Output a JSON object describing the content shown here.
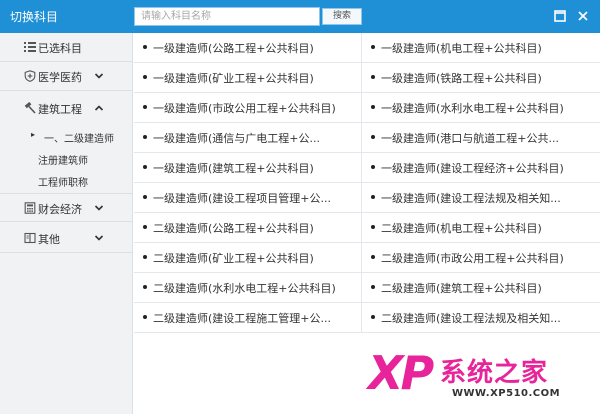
{
  "window": {
    "title": "切换科目"
  },
  "search": {
    "placeholder": "请输入科目名称",
    "button_label": "搜索"
  },
  "sidebar": {
    "items": [
      {
        "label": "已选科目",
        "icon": "list-icon"
      },
      {
        "label": "医学医药",
        "icon": "shield-icon",
        "expanded": false
      },
      {
        "label": "建筑工程",
        "icon": "hammer-icon",
        "expanded": true
      },
      {
        "label": "财会经济",
        "icon": "calculator-icon",
        "expanded": false
      },
      {
        "label": "其他",
        "icon": "book-icon",
        "expanded": false
      }
    ],
    "subitems": [
      {
        "label": "一、二级建造师",
        "active": true,
        "marker": "▸"
      },
      {
        "label": "注册建筑师",
        "active": false
      },
      {
        "label": "工程师职称",
        "active": false
      }
    ]
  },
  "subjects": {
    "rows": [
      [
        "一级建造师(公路工程+公共科目)",
        "一级建造师(机电工程+公共科目)"
      ],
      [
        "一级建造师(矿业工程+公共科目)",
        "一级建造师(铁路工程+公共科目)"
      ],
      [
        "一级建造师(市政公用工程+公共科目)",
        "一级建造师(水利水电工程+公共科目)"
      ],
      [
        "一级建造师(通信与广电工程+公...",
        "一级建造师(港口与航道工程+公共..."
      ],
      [
        "一级建造师(建筑工程+公共科目)",
        "一级建造师(建设工程经济+公共科目)"
      ],
      [
        "一级建造师(建设工程项目管理+公...",
        "一级建造师(建设工程法规及相关知..."
      ],
      [
        "二级建造师(公路工程+公共科目)",
        "二级建造师(机电工程+公共科目)"
      ],
      [
        "二级建造师(矿业工程+公共科目)",
        "二级建造师(市政公用工程+公共科目)"
      ],
      [
        "二级建造师(水利水电工程+公共科目)",
        "二级建造师(建筑工程+公共科目)"
      ],
      [
        "二级建造师(建设工程施工管理+公...",
        "二级建造师(建设工程法规及相关知..."
      ]
    ]
  },
  "watermark": {
    "logo": "XP",
    "brand": "系统之家",
    "url": "WWW.XP510.COM"
  },
  "colors": {
    "titlebar": "#1f8fd6",
    "sidebar_bg": "#f0f2f4",
    "watermark": "#e8249a"
  }
}
